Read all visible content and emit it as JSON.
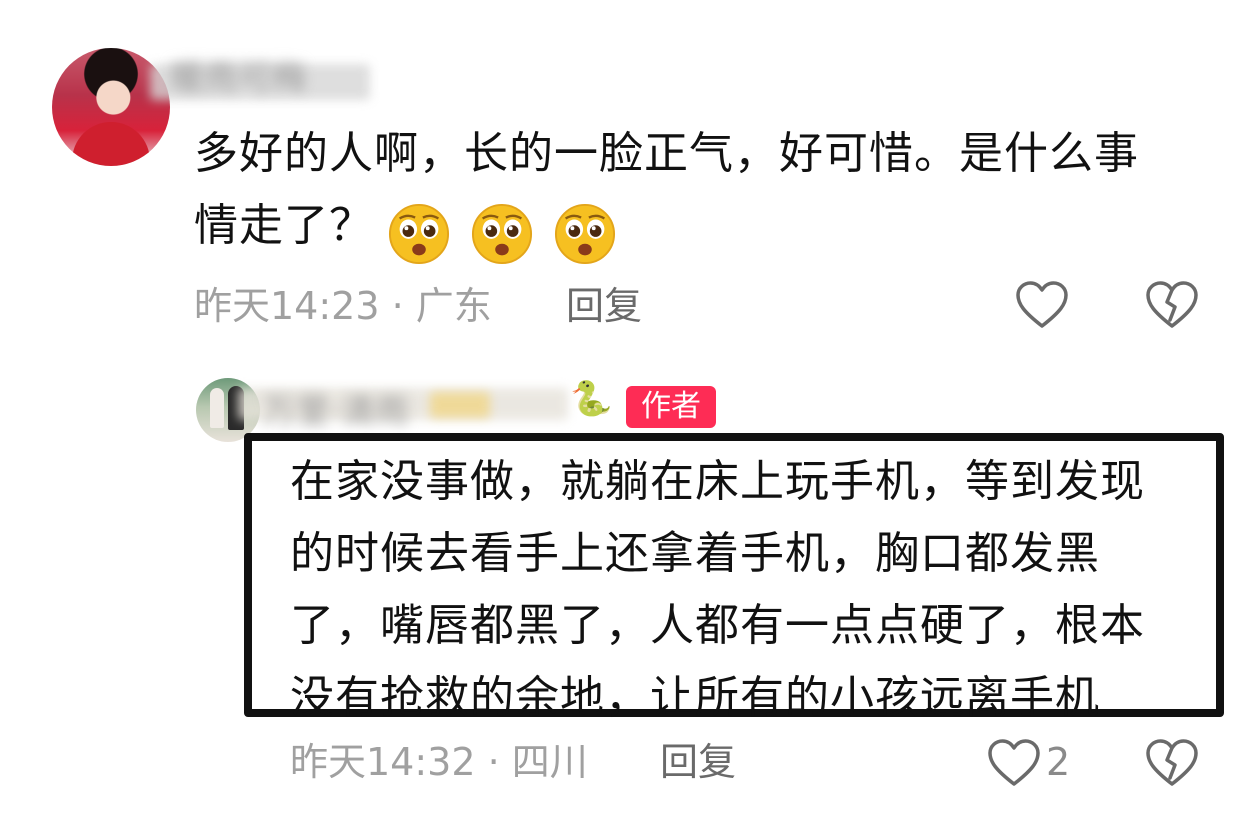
{
  "comment_1": {
    "username": "暖雨可梅",
    "text_line_1": "多好的人啊，长的一脸正气，好可惜。是什么事",
    "text_line_2": "情走了？",
    "emojis": [
      "pleading-face-icon",
      "pleading-face-icon",
      "pleading-face-icon"
    ],
    "time": "昨天14:23",
    "separator": "·",
    "location": "广东",
    "reply_label": "回复",
    "like_count": ""
  },
  "comment_2": {
    "username": "万里·清雨",
    "badge": "作者",
    "text_line_1": "在家没事做，就躺在床上玩手机，等到发现",
    "text_line_2": "的时候去看手上还拿着手机，胸口都发黑",
    "text_line_3": "了，嘴唇都黑了，人都有一点点硬了，根本",
    "text_line_4": "没有抢救的余地，让所有的小孩远离手机",
    "time": "昨天14:32",
    "separator": "·",
    "location": "四川",
    "reply_label": "回复",
    "like_count": "2"
  },
  "colors": {
    "author_badge": "#fe2c55",
    "meta_text": "#a0a0a0",
    "frame": "#111111"
  }
}
